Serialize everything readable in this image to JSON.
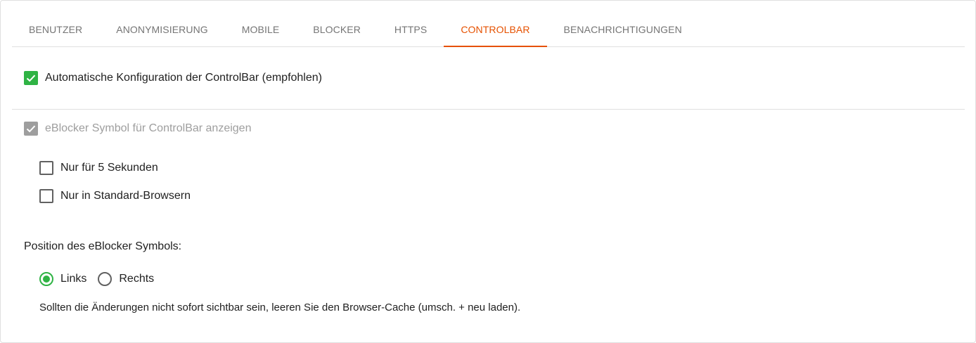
{
  "tabs": [
    {
      "label": "BENUTZER"
    },
    {
      "label": "ANONYMISIERUNG"
    },
    {
      "label": "MOBILE"
    },
    {
      "label": "BLOCKER"
    },
    {
      "label": "HTTPS"
    },
    {
      "label": "CONTROLBAR",
      "active": true
    },
    {
      "label": "BENACHRICHTIGUNGEN"
    }
  ],
  "auto_config": {
    "label": "Automatische Konfiguration der ControlBar (empfohlen)",
    "checked": true
  },
  "show_icon": {
    "label": "eBlocker Symbol für ControlBar anzeigen",
    "checked": true,
    "disabled": true
  },
  "only_5_seconds": {
    "label": "Nur für 5 Sekunden",
    "checked": false
  },
  "only_standard_browsers": {
    "label": "Nur in Standard-Browsern",
    "checked": false
  },
  "position": {
    "label": "Position des eBlocker Symbols:",
    "options": [
      {
        "label": "Links",
        "selected": true
      },
      {
        "label": "Rechts",
        "selected": false
      }
    ]
  },
  "hint": "Sollten die Änderungen nicht sofort sichtbar sein, leeren Sie den Browser-Cache (umsch. + neu laden).",
  "colors": {
    "accent": "#e65100",
    "check": "#2fb344",
    "disabled": "#9e9e9e"
  }
}
